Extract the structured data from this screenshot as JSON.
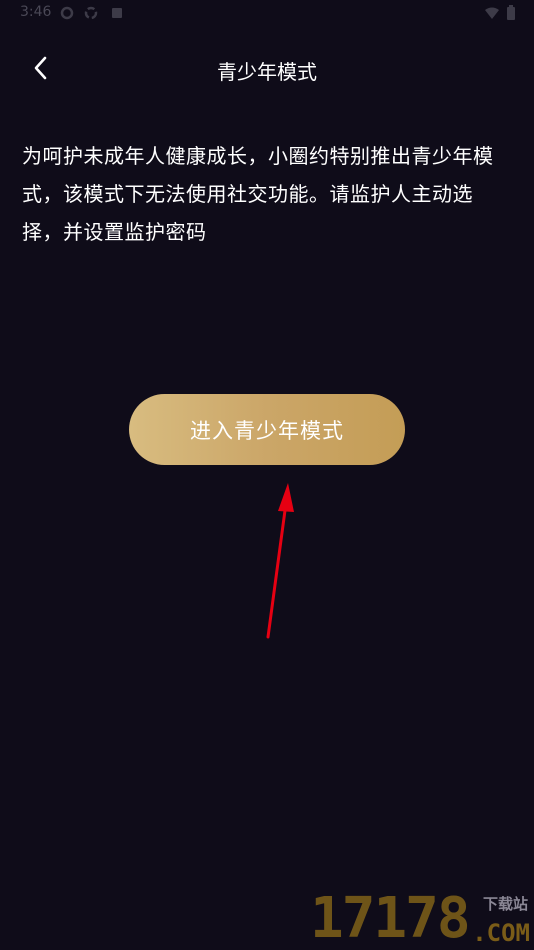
{
  "status_bar": {
    "time": "3:46",
    "icons": [
      "settings-icon",
      "sync-icon",
      "notification-icon",
      "wifi-icon",
      "battery-icon"
    ]
  },
  "nav": {
    "back_icon": "chevron-left-icon",
    "title": "青少年模式"
  },
  "content": {
    "description_lines": [
      "为呵护未成年人健康成长，小圈约特别推出青少年模",
      "式，该模式下无法使用社交功能。请监护人主动选",
      "择，并设置监护密码"
    ]
  },
  "actions": {
    "enter_label": "进入青少年模式"
  },
  "watermark": {
    "digits": "17178",
    "site": "下载站",
    "suffix": ".COM"
  },
  "colors": {
    "background": "#0f0c19",
    "button_gold_start": "#d8bc80",
    "button_gold_end": "#c49d56",
    "annotation_arrow": "#e60012"
  }
}
